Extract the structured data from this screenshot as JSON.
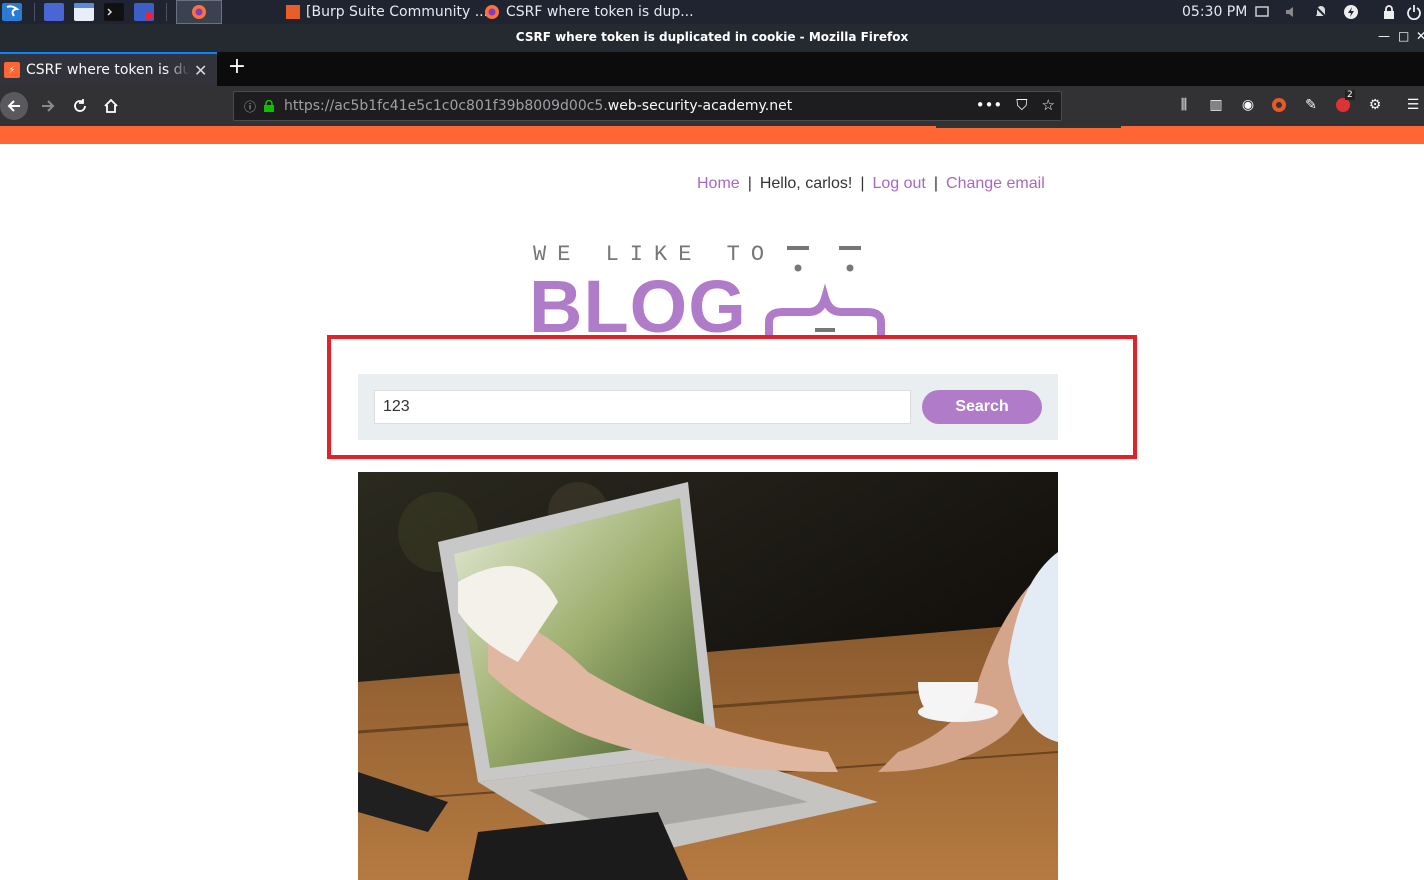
{
  "taskbar": {
    "tasks": [
      {
        "label": "[Burp Suite Community ..."
      },
      {
        "label": "CSRF where token is dup..."
      }
    ],
    "clock": "05:30 PM",
    "notification_badge": "2"
  },
  "window": {
    "title": "CSRF where token is duplicated in cookie - Mozilla Firefox"
  },
  "browser": {
    "tab_title": "CSRF where token is duplicated in cookie",
    "new_tab_label": "+",
    "url_prefix": "https://ac5b1fc41e5c1c0c801f39b8009d00c5.",
    "url_domain": "web-security-academy.net"
  },
  "page": {
    "nav": {
      "home": "Home",
      "separator": "|",
      "greeting": "Hello, carlos!",
      "logout": "Log out",
      "change_email": "Change email"
    },
    "logo": {
      "tagline": "WE LIKE TO",
      "title": "BLOG"
    },
    "search": {
      "value": "123",
      "button_label": "Search"
    }
  },
  "colors": {
    "accent": "#b07bc8",
    "brand_orange": "#ff6633",
    "highlight_red": "#e0232b"
  }
}
